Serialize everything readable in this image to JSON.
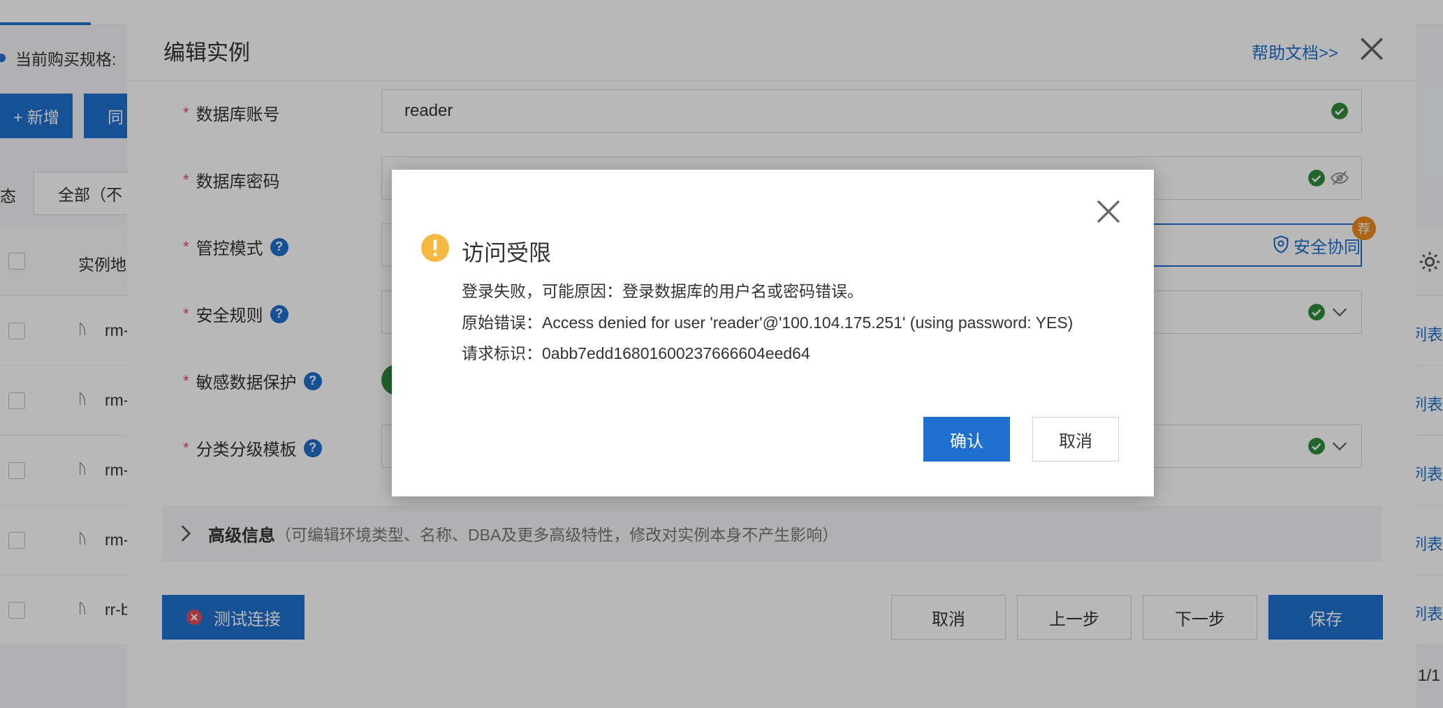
{
  "background": {
    "spec_label": "当前购买规格:",
    "add_button": "+ 新增",
    "sync_button": "同",
    "status_label": "态",
    "status_select": "全部（不",
    "column_header": "实例地",
    "rows": [
      {
        "name": "rm-",
        "action": "列表"
      },
      {
        "name": "rm-",
        "action": "列表"
      },
      {
        "name": "rm-",
        "action": "列表"
      },
      {
        "name": "rm-",
        "action": "列表"
      },
      {
        "name": "rr-b",
        "action": "列表"
      }
    ],
    "pager": "1/1"
  },
  "drawer": {
    "title": "编辑实例",
    "help_link": "帮助文档>>",
    "fields": {
      "account": {
        "label": "数据库账号",
        "value": "reader"
      },
      "password": {
        "label": "数据库密码",
        "value": ""
      },
      "control_mode": {
        "label": "管控模式",
        "selected_option": "安全协同",
        "badge": "荐"
      },
      "security_rule": {
        "label": "安全规则"
      },
      "sensitive_protect": {
        "label": "敏感数据保护"
      },
      "classify_template": {
        "label": "分类分级模板"
      }
    },
    "required_mark": "*",
    "help_mark": "?",
    "advanced": {
      "title": "高级信息",
      "desc": "（可编辑环境类型、名称、DBA及更多高级特性，修改对实例本身不产生影响）"
    },
    "footer": {
      "test_connection": "测试连接",
      "cancel": "取消",
      "prev": "上一步",
      "next": "下一步",
      "save": "保存"
    }
  },
  "modal": {
    "title": "访问受限",
    "lines": [
      "登录失败，可能原因：登录数据库的用户名或密码错误。",
      "原始错误：Access denied for user 'reader'@'100.104.175.251' (using password: YES)",
      "请求标识：0abb7edd16801600237666604eed64"
    ],
    "confirm": "确认",
    "cancel": "取消"
  },
  "colors": {
    "primary": "#1f6fcf",
    "success": "#2e8b3d",
    "warning": "#f5b942",
    "danger": "#e34d59",
    "badge": "#f08c1c"
  },
  "icons": [
    "check-circle-icon",
    "eye-off-icon",
    "chevron-down-icon",
    "shield-icon",
    "warning-icon",
    "close-icon",
    "chevron-right-icon",
    "error-icon",
    "gear-icon",
    "database-icon"
  ]
}
